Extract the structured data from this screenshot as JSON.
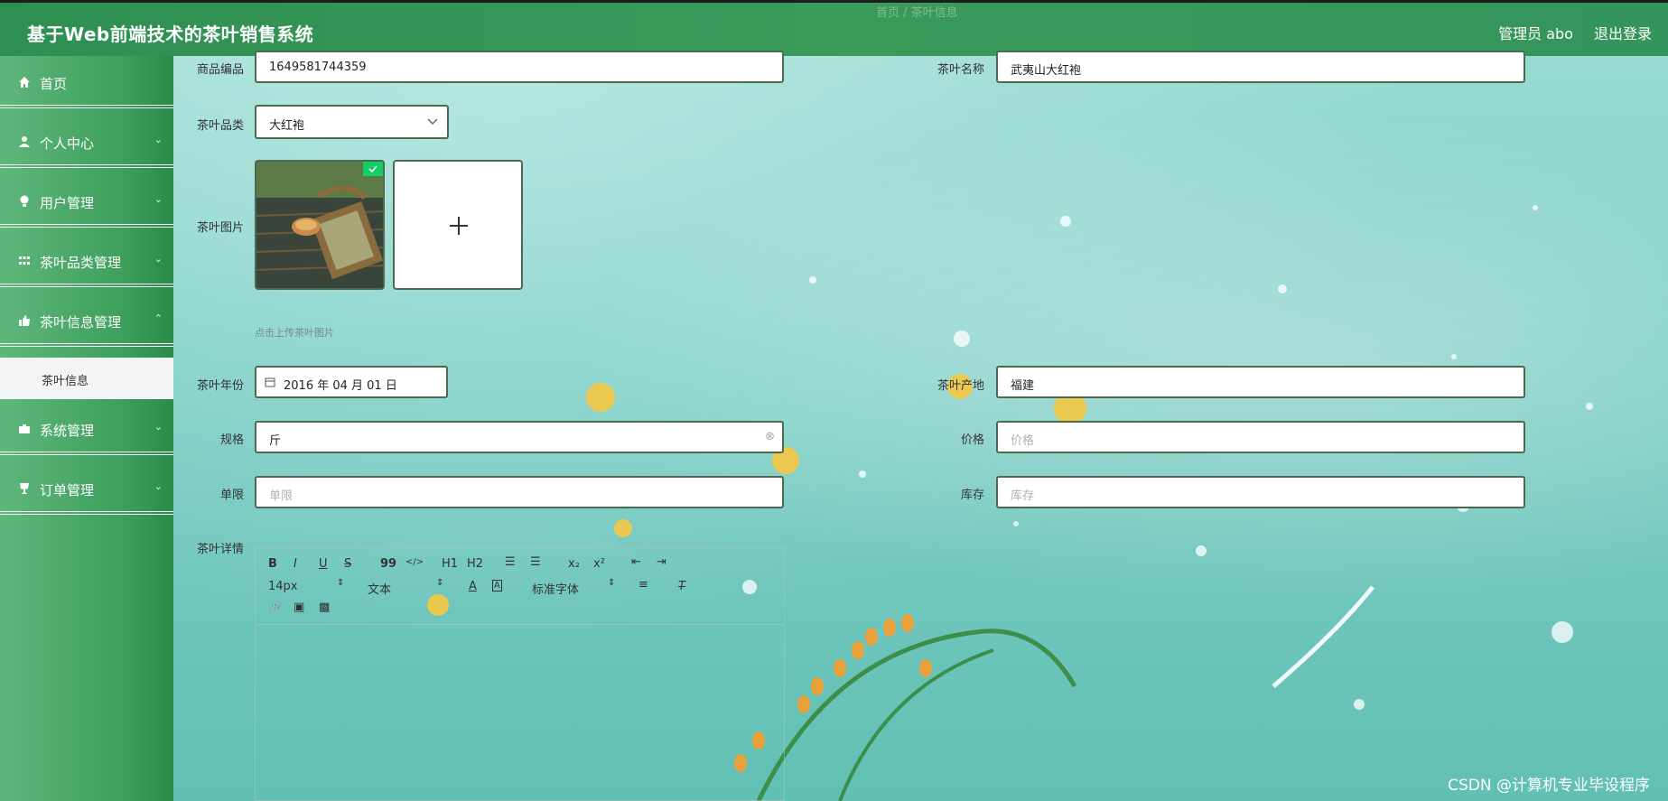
{
  "header": {
    "title": "基于Web前端技术的茶叶销售系统",
    "user": "管理员 abo",
    "logout": "退出登录",
    "breadcrumb": "首页  /  茶叶信息"
  },
  "sidebar": {
    "items": [
      {
        "label": "首页",
        "icon": "home-icon"
      },
      {
        "label": "个人中心",
        "icon": "user-icon"
      },
      {
        "label": "用户管理",
        "icon": "bulb-icon"
      },
      {
        "label": "茶叶品类管理",
        "icon": "grid-icon"
      },
      {
        "label": "茶叶信息管理",
        "icon": "thumb-icon"
      },
      {
        "label": "系统管理",
        "icon": "briefcase-icon"
      },
      {
        "label": "订单管理",
        "icon": "trophy-icon"
      }
    ],
    "subitem": "茶叶信息"
  },
  "form": {
    "code_label": "商品编品",
    "code_value": "1649581744359",
    "name_label": "茶叶名称",
    "name_value": "武夷山大红袍",
    "category_label": "茶叶品类",
    "category_value": "大红袍",
    "image_label": "茶叶图片",
    "image_hint": "点击上传茶叶图片",
    "year_label": "茶叶年份",
    "year_value": "2016 年 04 月 01 日",
    "origin_label": "茶叶产地",
    "origin_value": "福建",
    "spec_label": "规格",
    "spec_value": "斤",
    "price_label": "价格",
    "price_placeholder": "价格",
    "limit_label": "单限",
    "limit_placeholder": "单限",
    "stock_label": "库存",
    "stock_placeholder": "库存",
    "detail_label": "茶叶详情"
  },
  "editor": {
    "toolbar_row1": [
      "B",
      "I",
      "U",
      "S",
      "99",
      "</>",
      "H1",
      "H2",
      "ol",
      "ul",
      "x₂",
      "x²",
      "outdent",
      "indent"
    ],
    "font_size": "14px",
    "text_type": "文本",
    "font_family": "标准字体"
  },
  "watermark": "CSDN @计算机专业毕设程序",
  "colors": {
    "header": "#3a9a5a",
    "sidebar": "#3e9f5c",
    "field_border": "#4b6a4f"
  }
}
